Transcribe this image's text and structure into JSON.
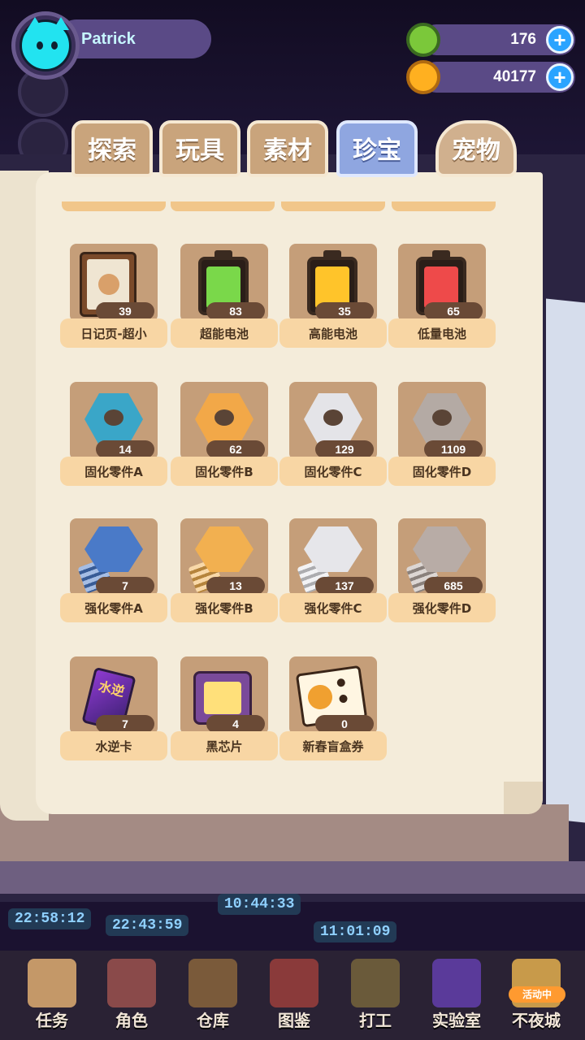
{
  "player": {
    "name": "Patrick"
  },
  "currencies": [
    {
      "id": "donut",
      "value": "176",
      "color": "#7bc83a"
    },
    {
      "id": "planet",
      "value": "40177",
      "color": "#ffb020"
    }
  ],
  "tabs": [
    {
      "label": "探索",
      "active": false
    },
    {
      "label": "玩具",
      "active": false
    },
    {
      "label": "素材",
      "active": false
    },
    {
      "label": "珍宝",
      "active": true
    },
    {
      "label": "宠物",
      "active": false
    }
  ],
  "items": [
    {
      "name": "日记页-超小",
      "count": "39",
      "icon": "diary-page-icon"
    },
    {
      "name": "超能电池",
      "count": "83",
      "icon": "battery-icon",
      "color": "#7ad84a"
    },
    {
      "name": "高能电池",
      "count": "35",
      "icon": "battery-icon",
      "color": "#ffc42a"
    },
    {
      "name": "低量电池",
      "count": "65",
      "icon": "battery-icon",
      "color": "#ee4a4a"
    },
    {
      "name": "固化零件A",
      "count": "14",
      "icon": "nut-icon",
      "color": "#3aa6c8"
    },
    {
      "name": "固化零件B",
      "count": "62",
      "icon": "nut-icon",
      "color": "#f2a848"
    },
    {
      "name": "固化零件C",
      "count": "129",
      "icon": "nut-icon",
      "color": "#e4e4e8"
    },
    {
      "name": "固化零件D",
      "count": "1109",
      "icon": "nut-icon",
      "color": "#b4aaa4"
    },
    {
      "name": "强化零件A",
      "count": "7",
      "icon": "bolt-icon",
      "color": "#4a7ac8"
    },
    {
      "name": "强化零件B",
      "count": "13",
      "icon": "bolt-icon",
      "color": "#f2b050"
    },
    {
      "name": "强化零件C",
      "count": "137",
      "icon": "bolt-icon",
      "color": "#e6e6ea"
    },
    {
      "name": "强化零件D",
      "count": "685",
      "icon": "bolt-icon",
      "color": "#b8aca6"
    },
    {
      "name": "水逆卡",
      "count": "7",
      "icon": "card-icon",
      "card_text": "水逆"
    },
    {
      "name": "黑芯片",
      "count": "4",
      "icon": "chip-icon"
    },
    {
      "name": "新春盲盒券",
      "count": "0",
      "icon": "ticket-icon"
    }
  ],
  "timers": [
    "22:58:12",
    "22:43:59",
    "10:44:33",
    "11:01:09"
  ],
  "nav": [
    {
      "label": "任务",
      "icon": "task-icon"
    },
    {
      "label": "角色",
      "icon": "character-icon"
    },
    {
      "label": "仓库",
      "icon": "warehouse-icon"
    },
    {
      "label": "图鉴",
      "icon": "catalog-icon"
    },
    {
      "label": "打工",
      "icon": "work-icon"
    },
    {
      "label": "实验室",
      "icon": "lab-icon"
    },
    {
      "label": "不夜城",
      "icon": "nightcity-icon"
    }
  ],
  "badge": "活动中"
}
